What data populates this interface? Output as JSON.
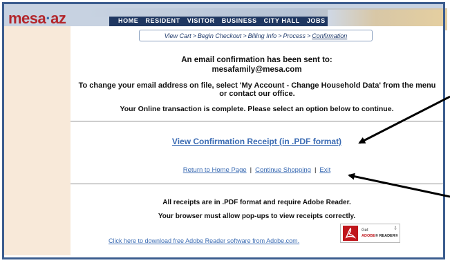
{
  "header": {
    "logo_text_a": "mesa",
    "logo_text_dot": "·",
    "logo_text_b": "az",
    "nav": [
      "HOME",
      "RESIDENT",
      "VISITOR",
      "BUSINESS",
      "CITY HALL",
      "JOBS"
    ]
  },
  "breadcrumb": {
    "items": [
      "View Cart",
      "Begin Checkout",
      "Billing Info",
      "Process",
      "Confirmation"
    ],
    "separator": ">"
  },
  "confirmation": {
    "email_heading": "An email confirmation has been sent to:",
    "email_address": "mesafamily@mesa.com",
    "change_text": "To change your email address on file, select 'My Account - Change Household Data' from the menu or contact our office.",
    "complete_text": "Your Online transaction is complete. Please select an option below to continue."
  },
  "links": {
    "receipt": "View Confirmation Receipt (in .PDF format)",
    "home": "Return to Home Page",
    "shopping": "Continue Shopping",
    "exit": "Exit",
    "separator": "|"
  },
  "notes": {
    "pdf_note": "All receipts are in .PDF format and require Adobe Reader.",
    "popup_note": "Your browser must allow pop-ups to view receipts correctly.",
    "download_link": "Click here to download free Adobe Reader software from Adobe.com."
  },
  "adobe_badge": {
    "get": "Get",
    "reader_a": "ADOBE",
    "reader_b": "® READER",
    "reader_c": "®",
    "download_icon": "download-arrow-icon"
  },
  "colors": {
    "border": "#3b5c8e",
    "logo_red": "#b3262b",
    "nav_bg": "#1f3761",
    "left_col": "#f8e9d9",
    "link": "#3a6bb3",
    "annotation_arrow": "#000000"
  }
}
